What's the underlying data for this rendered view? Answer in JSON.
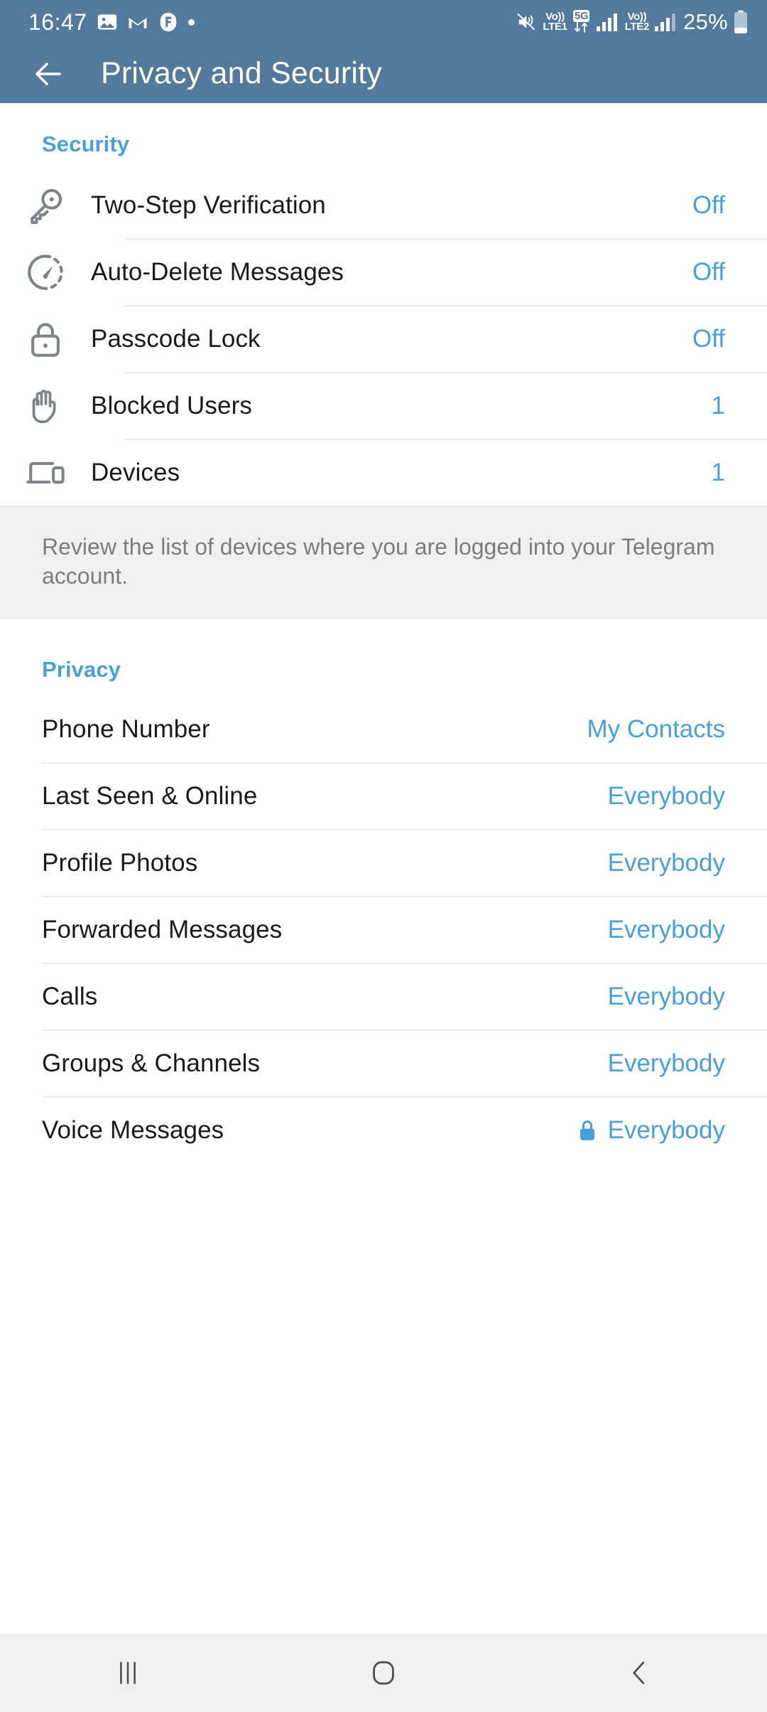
{
  "statusbar": {
    "time": "16:47",
    "icons": [
      "image-icon",
      "gmail-icon",
      "app-badge-icon",
      "dot-icon"
    ],
    "mute_icon": "volume-mute-icon",
    "volte1": {
      "top": "Vo))",
      "bottom": "LTE1"
    },
    "network_tag": "5G",
    "volte2": {
      "top": "Vo))",
      "bottom": "LTE2"
    },
    "battery_percent": "25%"
  },
  "appbar": {
    "back_icon": "back-arrow-icon",
    "title": "Privacy and Security"
  },
  "security": {
    "header": "Security",
    "items": [
      {
        "icon": "key-icon",
        "label": "Two-Step Verification",
        "value": "Off"
      },
      {
        "icon": "auto-delete-icon",
        "label": "Auto-Delete Messages",
        "value": "Off"
      },
      {
        "icon": "lock-icon",
        "label": "Passcode Lock",
        "value": "Off"
      },
      {
        "icon": "blocked-hand-icon",
        "label": "Blocked Users",
        "value": "1"
      },
      {
        "icon": "devices-icon",
        "label": "Devices",
        "value": "1"
      }
    ],
    "info": "Review the list of devices where you are logged into your Telegram account."
  },
  "privacy": {
    "header": "Privacy",
    "items": [
      {
        "label": "Phone Number",
        "value": "My Contacts",
        "premium": false
      },
      {
        "label": "Last Seen & Online",
        "value": "Everybody",
        "premium": false
      },
      {
        "label": "Profile Photos",
        "value": "Everybody",
        "premium": false
      },
      {
        "label": "Forwarded Messages",
        "value": "Everybody",
        "premium": false
      },
      {
        "label": "Calls",
        "value": "Everybody",
        "premium": false
      },
      {
        "label": "Groups & Channels",
        "value": "Everybody",
        "premium": false
      },
      {
        "label": "Voice Messages",
        "value": "Everybody",
        "premium": true
      }
    ]
  },
  "navbar": {
    "recents": "recents-icon",
    "home": "home-icon",
    "back": "back-nav-icon"
  },
  "colors": {
    "appbar": "#527a9c",
    "accent": "#4a9fd8",
    "info_bg": "#f0f0f0",
    "text": "#1a1a1a",
    "muted": "#7d7d7d"
  }
}
